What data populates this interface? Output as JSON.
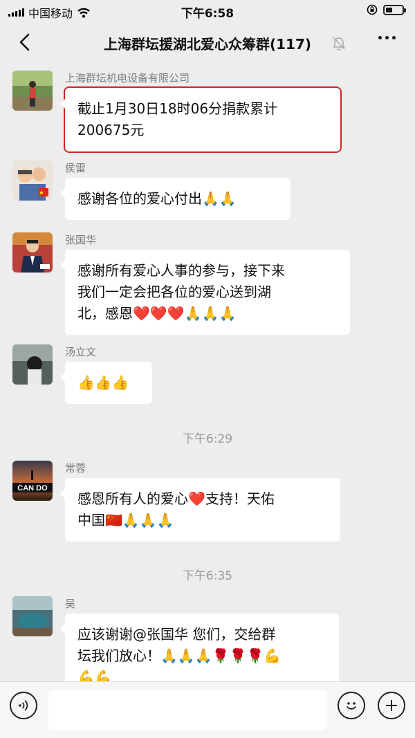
{
  "status_bar": {
    "carrier": "中国移动",
    "time": "下午6:58"
  },
  "nav": {
    "title": "上海群坛援湖北爱心众筹群(117)",
    "icons": [
      "back-chevron-icon",
      "mute-bell-icon",
      "more-dots-icon"
    ]
  },
  "messages": [
    {
      "sender": "上海群坛机电设备有限公司",
      "lines": [
        "截止1月30日18时06分捐款累计",
        "200675元"
      ],
      "highlight_color": "#d32424"
    },
    {
      "sender": "侯雷",
      "lines": [
        "感谢各位的爱心付出🙏🙏"
      ]
    },
    {
      "sender": "张国华",
      "lines": [
        "感谢所有爱心人事的参与，接下来",
        "我们一定会把各位的爱心送到湖",
        "北，感恩❤️❤️❤️🙏🙏🙏"
      ]
    },
    {
      "sender": "汤立文",
      "lines": [
        "👍👍👍"
      ]
    },
    {
      "sender": "常蓉",
      "avatar_text": "CAN DO",
      "lines": [
        "感恩所有人的爱心❤️支持！天佑",
        "中国🇨🇳🙏🙏🙏"
      ]
    },
    {
      "sender": "吴",
      "lines": [
        "应该谢谢@张国华 您们，交给群",
        "坛我们放心！🙏🙏🙏🌹🌹🌹💪",
        "💪💪"
      ]
    }
  ],
  "timestamps": [
    "下午6:29",
    "下午6:35"
  ],
  "input_bar": {
    "icons": [
      "voice-icon",
      "emoji-icon",
      "plus-icon"
    ]
  },
  "colors": {
    "background": "#ededed",
    "bubble": "#ffffff",
    "highlight": "#d32424"
  }
}
